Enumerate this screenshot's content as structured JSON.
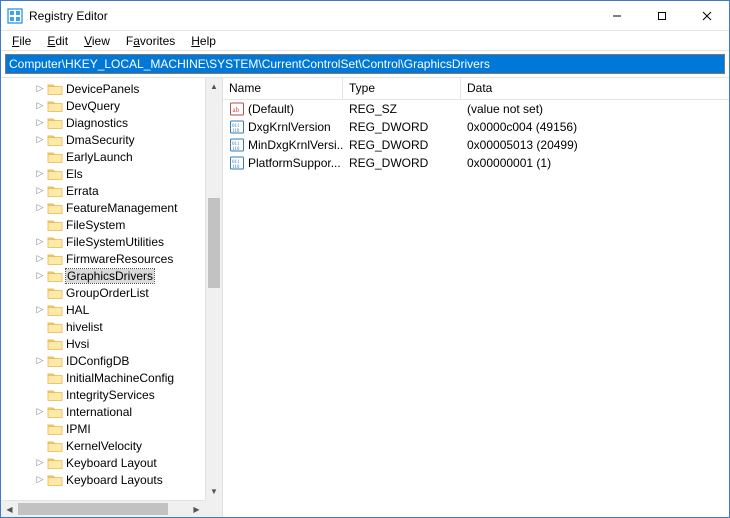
{
  "title": "Registry Editor",
  "window_controls": {
    "min": "−",
    "max": "☐",
    "close": "✕"
  },
  "menu": {
    "file": "File",
    "edit": "Edit",
    "view": "View",
    "favorites": "Favorites",
    "help": "Help"
  },
  "address": "Computer\\HKEY_LOCAL_MACHINE\\SYSTEM\\CurrentControlSet\\Control\\GraphicsDrivers",
  "tree": {
    "nodes": [
      {
        "label": "DevicePanels",
        "expandable": true
      },
      {
        "label": "DevQuery",
        "expandable": true
      },
      {
        "label": "Diagnostics",
        "expandable": true
      },
      {
        "label": "DmaSecurity",
        "expandable": true
      },
      {
        "label": "EarlyLaunch",
        "expandable": false
      },
      {
        "label": "Els",
        "expandable": true
      },
      {
        "label": "Errata",
        "expandable": true
      },
      {
        "label": "FeatureManagement",
        "expandable": true
      },
      {
        "label": "FileSystem",
        "expandable": false
      },
      {
        "label": "FileSystemUtilities",
        "expandable": true
      },
      {
        "label": "FirmwareResources",
        "expandable": true
      },
      {
        "label": "GraphicsDrivers",
        "expandable": true,
        "selected": true
      },
      {
        "label": "GroupOrderList",
        "expandable": false
      },
      {
        "label": "HAL",
        "expandable": true
      },
      {
        "label": "hivelist",
        "expandable": false
      },
      {
        "label": "Hvsi",
        "expandable": false
      },
      {
        "label": "IDConfigDB",
        "expandable": true
      },
      {
        "label": "InitialMachineConfig",
        "expandable": false
      },
      {
        "label": "IntegrityServices",
        "expandable": false
      },
      {
        "label": "International",
        "expandable": true
      },
      {
        "label": "IPMI",
        "expandable": false
      },
      {
        "label": "KernelVelocity",
        "expandable": false
      },
      {
        "label": "Keyboard Layout",
        "expandable": true
      },
      {
        "label": "Keyboard Layouts",
        "expandable": true
      }
    ]
  },
  "list": {
    "columns": {
      "name": "Name",
      "type": "Type",
      "data": "Data"
    },
    "rows": [
      {
        "icon": "string",
        "name": "(Default)",
        "type": "REG_SZ",
        "data": "(value not set)"
      },
      {
        "icon": "binary",
        "name": "DxgKrnlVersion",
        "type": "REG_DWORD",
        "data": "0x0000c004 (49156)"
      },
      {
        "icon": "binary",
        "name": "MinDxgKrnlVersi...",
        "type": "REG_DWORD",
        "data": "0x00005013 (20499)"
      },
      {
        "icon": "binary",
        "name": "PlatformSuppor...",
        "type": "REG_DWORD",
        "data": "0x00000001 (1)"
      }
    ]
  }
}
